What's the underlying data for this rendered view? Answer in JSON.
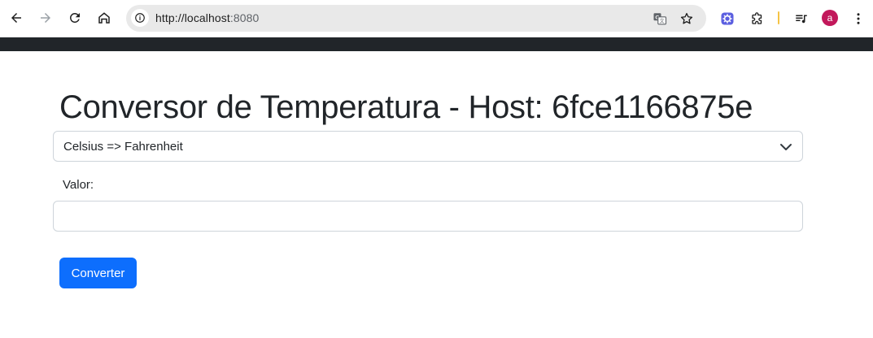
{
  "browser": {
    "url_host": "http://localhost",
    "url_port": ":8080",
    "avatar_letter": "a",
    "icons": {
      "back": "arrow-left-icon",
      "forward": "arrow-right-icon",
      "reload": "reload-icon",
      "home": "home-icon",
      "site_info": "info-icon",
      "translate": "translate-icon",
      "bookmark": "star-icon",
      "extension_app": "extension-gear-icon",
      "extensions": "puzzle-icon",
      "media": "playlist-icon",
      "menu": "kebab-menu-icon"
    }
  },
  "page": {
    "title": "Conversor de Temperatura - Host: 6fce1166875e",
    "conversion_select": {
      "selected": "Celsius => Fahrenheit"
    },
    "value_field": {
      "label": "Valor:",
      "value": "",
      "placeholder": ""
    },
    "submit_label": "Converter"
  },
  "colors": {
    "navbar": "#212529",
    "primary": "#0d6efd",
    "text": "#212529",
    "border": "#ced4da"
  }
}
